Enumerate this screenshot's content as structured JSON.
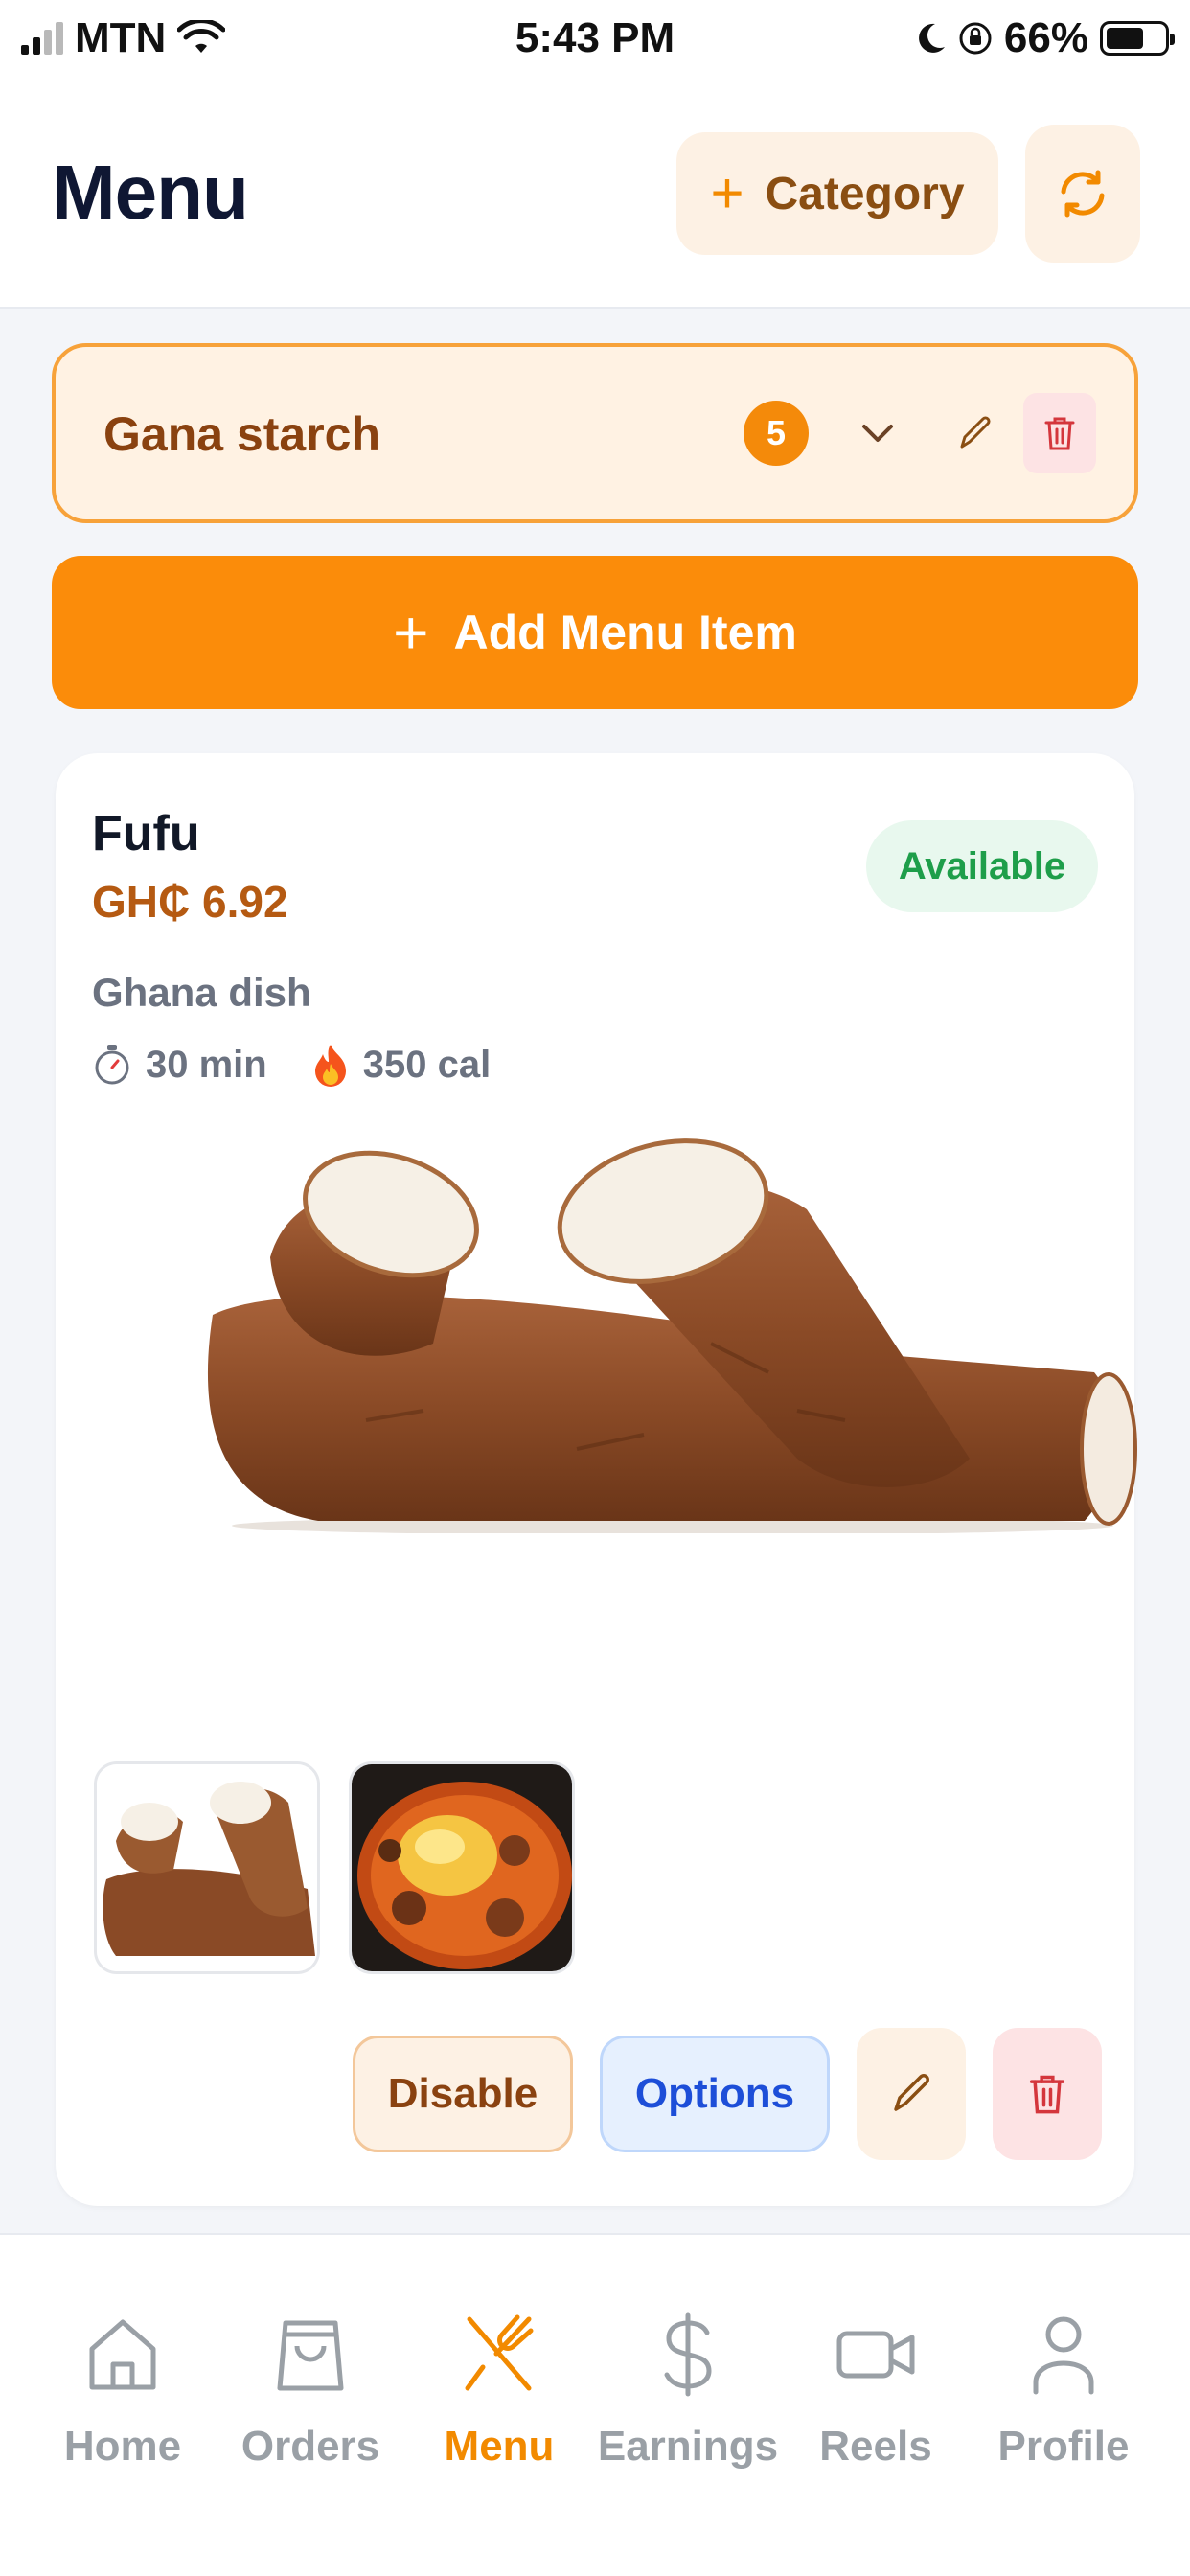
{
  "status_bar": {
    "carrier": "MTN",
    "time": "5:43 PM",
    "battery": "66%"
  },
  "header": {
    "title": "Menu",
    "category_button": "Category"
  },
  "category": {
    "name": "Gana starch",
    "count": "5"
  },
  "add_button": {
    "label": "Add Menu Item"
  },
  "item": {
    "name": "Fufu",
    "price": "GH₵ 6.92",
    "status": "Available",
    "description": "Ghana dish",
    "time": "30 min",
    "calories": "350 cal",
    "actions": {
      "disable": "Disable",
      "options": "Options"
    }
  },
  "tabs": [
    {
      "label": "Home",
      "icon": "home-icon"
    },
    {
      "label": "Orders",
      "icon": "shopping-bag-icon"
    },
    {
      "label": "Menu",
      "icon": "utensils-icon"
    },
    {
      "label": "Earnings",
      "icon": "dollar-icon"
    },
    {
      "label": "Reels",
      "icon": "video-icon"
    },
    {
      "label": "Profile",
      "icon": "user-icon"
    }
  ],
  "colors": {
    "accent": "#fb8c0a",
    "available": "#1e9e4a",
    "options": "#1d4ed8",
    "danger": "#d4363c"
  }
}
